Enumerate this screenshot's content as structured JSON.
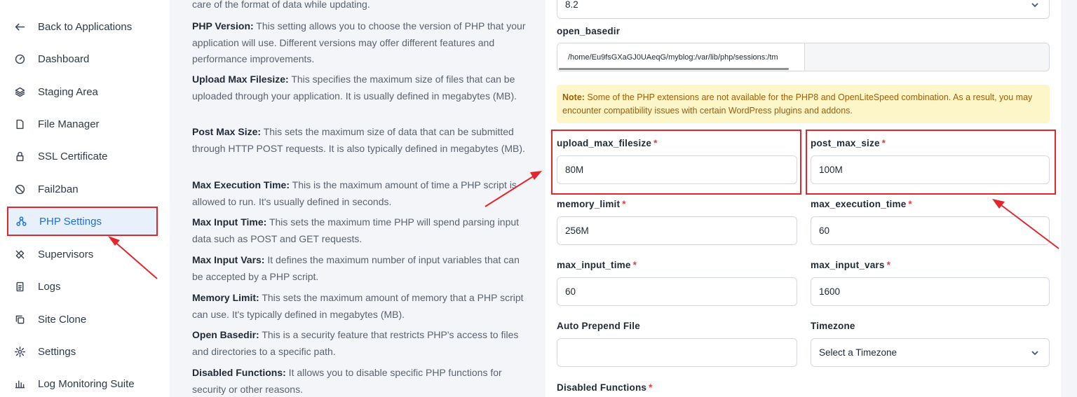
{
  "sidebar": {
    "items": [
      {
        "label": "Back to Applications",
        "icon": "arrow-left-icon"
      },
      {
        "label": "Dashboard",
        "icon": "dashboard-gauge-icon"
      },
      {
        "label": "Staging Area",
        "icon": "layers-icon"
      },
      {
        "label": "File Manager",
        "icon": "file-icon"
      },
      {
        "label": "SSL Certificate",
        "icon": "lock-icon"
      },
      {
        "label": "Fail2ban",
        "icon": "ban-icon"
      },
      {
        "label": "PHP Settings",
        "icon": "php-nodes-icon",
        "active": true
      },
      {
        "label": "Supervisors",
        "icon": "tools-icon"
      },
      {
        "label": "Logs",
        "icon": "document-icon"
      },
      {
        "label": "Site Clone",
        "icon": "copy-icon"
      },
      {
        "label": "Settings",
        "icon": "gear-icon"
      },
      {
        "label": "Log Monitoring Suite",
        "icon": "bar-chart-icon"
      }
    ]
  },
  "help": {
    "intro_tail": "care of the format of data while updating.",
    "items": [
      {
        "term": "PHP Version:",
        "text": " This setting allows you to choose the version of PHP that your application will use. Different versions may offer different features and performance improvements."
      },
      {
        "term": "Upload Max Filesize:",
        "text": " This specifies the maximum size of files that can be uploaded through your application. It is usually defined in megabytes (MB)."
      },
      {
        "term": "Post Max Size:",
        "text": " This sets the maximum size of data that can be submitted through HTTP POST requests. It is also typically defined in megabytes (MB)."
      },
      {
        "term": "Max Execution Time:",
        "text": " This is the maximum amount of time a PHP script is allowed to run. It's usually defined in seconds."
      },
      {
        "term": "Max Input Time:",
        "text": " This sets the maximum time PHP will spend parsing input data such as POST and GET requests."
      },
      {
        "term": "Max Input Vars:",
        "text": " It defines the maximum number of input variables that can be accepted by a PHP script."
      },
      {
        "term": "Memory Limit:",
        "text": " This sets the maximum amount of memory that a PHP script can use. It's typically defined in megabytes (MB)."
      },
      {
        "term": "Open Basedir:",
        "text": " This is a security feature that restricts PHP's access to files and directories to a specific path."
      },
      {
        "term": "Disabled Functions:",
        "text": " It allows you to disable specific PHP functions for security or other reasons."
      }
    ]
  },
  "form": {
    "php_version": {
      "value": "8.2"
    },
    "open_basedir": {
      "label": "open_basedir",
      "value": "/home/Eu9fsGXaGJ0UAeqG/myblog:/var/lib/php/sessions:/tm"
    },
    "note": {
      "label": "Note:",
      "text": " Some of the PHP extensions are not available for the PHP8 and OpenLiteSpeed combination. As a result, you may encounter compatibility issues with certain WordPress plugins and addons."
    },
    "upload_max_filesize": {
      "label": "upload_max_filesize",
      "value": "80M"
    },
    "post_max_size": {
      "label": "post_max_size",
      "value": "100M"
    },
    "memory_limit": {
      "label": "memory_limit",
      "value": "256M"
    },
    "max_execution_time": {
      "label": "max_execution_time",
      "value": "60"
    },
    "max_input_time": {
      "label": "max_input_time",
      "value": "60"
    },
    "max_input_vars": {
      "label": "max_input_vars",
      "value": "1600"
    },
    "auto_prepend_file": {
      "label": "Auto Prepend File",
      "value": ""
    },
    "timezone": {
      "label": "Timezone",
      "value": "Select a Timezone"
    },
    "disabled_functions": {
      "label": "Disabled Functions"
    },
    "required_mark": "*"
  },
  "colors": {
    "accent": "#1e6fd9",
    "highlight": "#e3262b",
    "required": "#e53e3e",
    "note_bg": "#fdf6c8",
    "note_text": "#a15c07"
  }
}
